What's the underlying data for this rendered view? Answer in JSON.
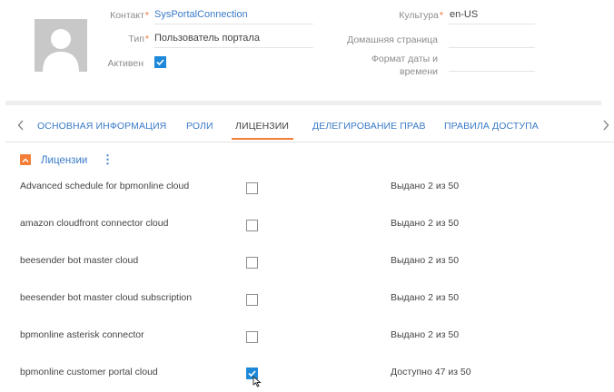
{
  "header": {
    "fields_left": [
      {
        "label": "Контакт",
        "required": true,
        "value": "SysPortalConnection",
        "is_link": true
      },
      {
        "label": "Тип",
        "required": true,
        "value": "Пользователь портала",
        "is_link": false
      },
      {
        "label": "Активен",
        "required": false,
        "checked": true
      }
    ],
    "fields_right": [
      {
        "label": "Культура",
        "required": true,
        "value": "en-US"
      },
      {
        "label": "Домашняя страница",
        "required": false,
        "value": ""
      },
      {
        "label_line1": "Формат даты и",
        "label_line2": "времени",
        "required": false,
        "value": ""
      }
    ],
    "required_mark": "*"
  },
  "tabs": {
    "items": [
      {
        "label": "ОСНОВНАЯ ИНФОРМАЦИЯ",
        "active": false
      },
      {
        "label": "РОЛИ",
        "active": false
      },
      {
        "label": "ЛИЦЕНЗИИ",
        "active": true
      },
      {
        "label": "ДЕЛЕГИРОВАНИЕ ПРАВ",
        "active": false
      },
      {
        "label": "ПРАВИЛА ДОСТУПА",
        "active": false
      }
    ],
    "prev_icon": "chevron-left-icon",
    "next_icon": "chevron-right-icon"
  },
  "licenses": {
    "title": "Лицензии",
    "menu_glyph": "⋮",
    "rows": [
      {
        "name": "Advanced schedule for bpmonline cloud",
        "checked": false,
        "status": "Выдано 2 из 50"
      },
      {
        "name": "amazon cloudfront connector cloud",
        "checked": false,
        "status": "Выдано 2 из 50"
      },
      {
        "name": "beesender bot master cloud",
        "checked": false,
        "status": "Выдано 2 из 50"
      },
      {
        "name": "beesender bot master cloud subscription",
        "checked": false,
        "status": "Выдано 2 из 50"
      },
      {
        "name": "bpmonline asterisk connector",
        "checked": false,
        "status": "Выдано 2 из 50"
      },
      {
        "name": "bpmonline customer portal cloud",
        "checked": true,
        "status": "Доступно 47 из 50"
      }
    ]
  },
  "colors": {
    "accent": "#f27e37",
    "link": "#3a7ac8",
    "checkbox_on": "#1e88d9"
  }
}
